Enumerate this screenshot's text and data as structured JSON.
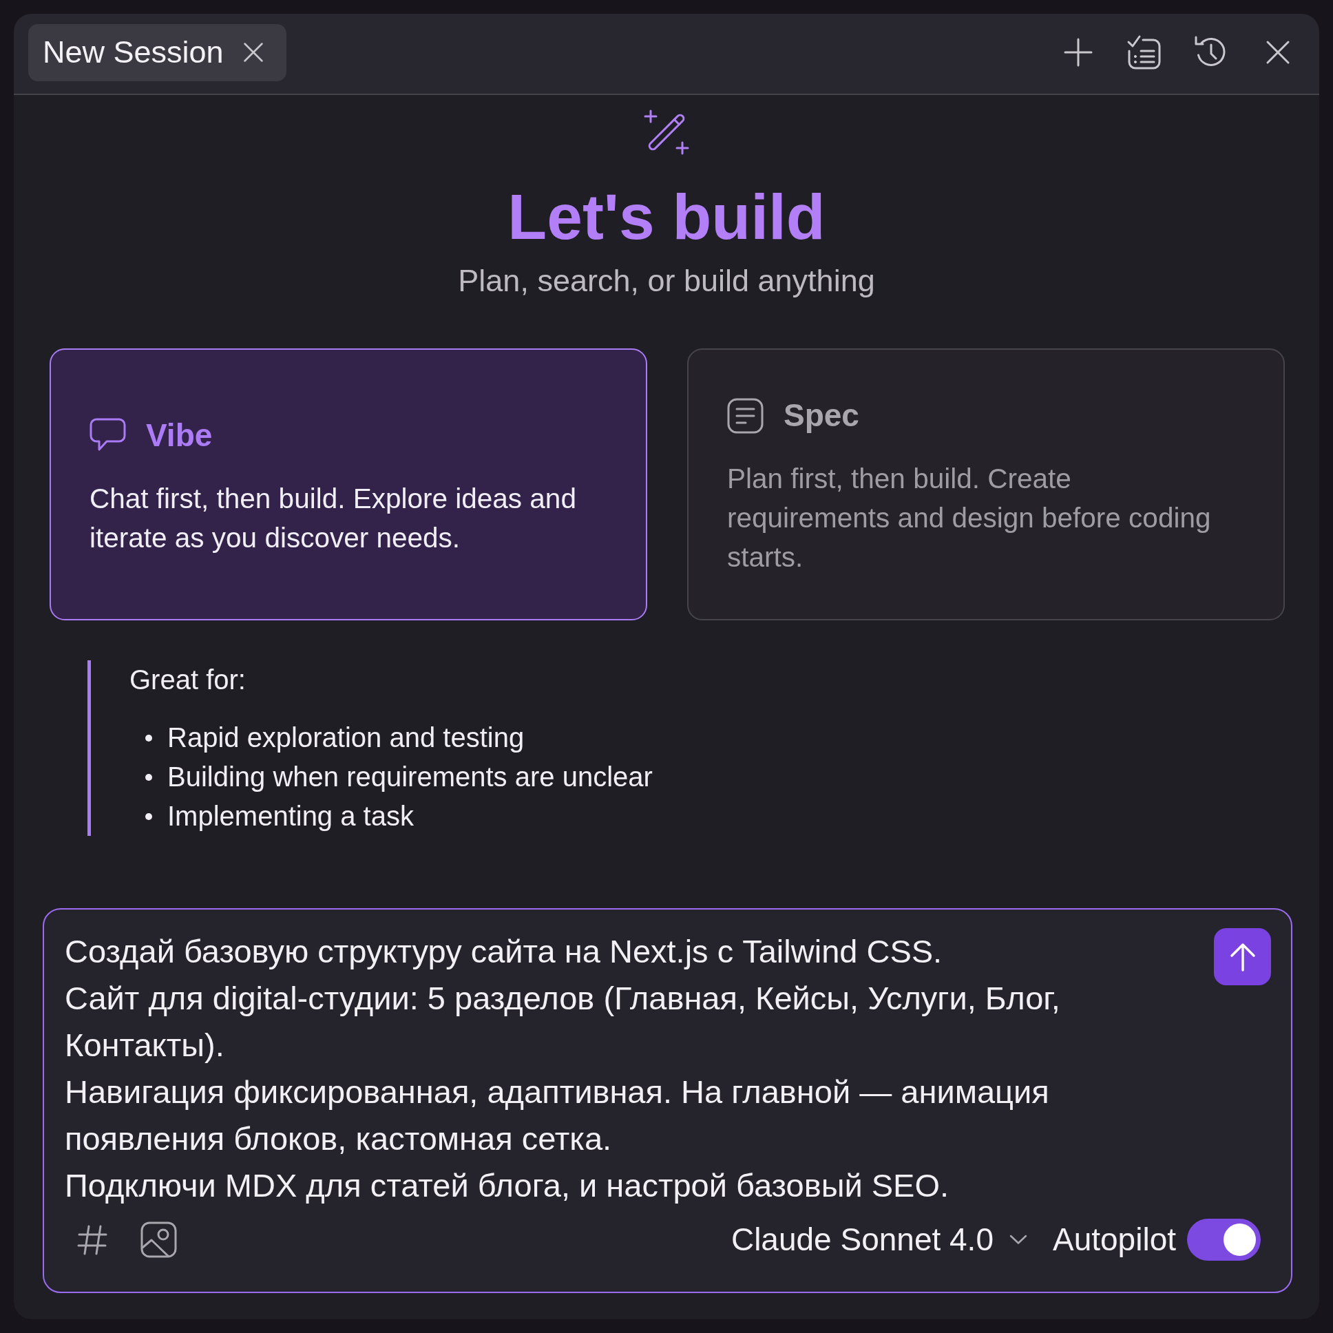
{
  "tabs": [
    {
      "label": "New Session",
      "selected": true
    }
  ],
  "hero": {
    "title": "Let's build",
    "subtitle": "Plan, search, or build anything"
  },
  "modes": [
    {
      "kind": "chat",
      "title": "Vibe",
      "description": "Chat first, then build. Explore ideas and iterate as you discover needs.",
      "selected": true
    },
    {
      "kind": "document",
      "title": "Spec",
      "description": "Plan first, then build. Create requirements and design before coding starts.",
      "selected": false
    }
  ],
  "details": {
    "heading": "Great for:",
    "items": [
      "Rapid exploration and testing",
      "Building when requirements are unclear",
      "Implementing a task"
    ]
  },
  "composer": {
    "value": "Создай базовую структуру сайта на Next.js с Tailwind CSS.\nСайт для digital-студии: 5 разделов (Главная, Кейсы, Услуги, Блог, Контакты).\nНавигация фиксированная, адаптивная. На главной — анимация появления блоков, кастомная сетка.\nПодключи MDX для статей блога, и настрой базовый SEO.",
    "model": "Claude Sonnet 4.0",
    "autopilot": {
      "label": "Autopilot",
      "on": true
    }
  }
}
